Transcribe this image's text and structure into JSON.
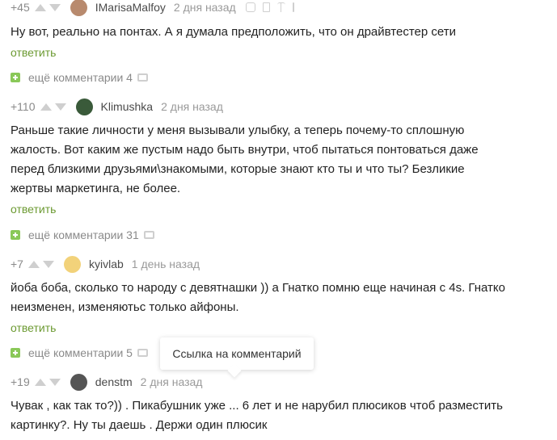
{
  "comments": [
    {
      "rating": "+45",
      "username": "IMarisaMalfoy",
      "time": "2 дня назад",
      "text": "Ну вот, реально на понтах. А я думала предположить, что он драйвтестер сети",
      "reply_label": "ответить",
      "more_label": "ещё комментарии 4",
      "avatar_color": "#b88a6e"
    },
    {
      "rating": "+110",
      "username": "Klimushka",
      "time": "2 дня назад",
      "text_lines": [
        "Раньше такие личности у меня вызывали улыбку, а теперь почему-то сплошную",
        "жалость. Вот каким же пустым надо быть внутри, чтоб пытаться понтоваться даже",
        "перед близкими друзьями\\знакомыми, которые знают кто ты и что ты? Безликие",
        "жертвы маркетинга, не более."
      ],
      "reply_label": "ответить",
      "more_label": "ещё комментарии 31",
      "avatar_color": "#3a5a3a"
    },
    {
      "rating": "+7",
      "username": "kyivlab",
      "time": "1 день назад",
      "text_lines": [
        "йоба боба, сколько то народу с девятнашки )) а Гнатко помню еще начиная с 4s. Гнатко",
        "неизменен, изменяютьс только айфоны."
      ],
      "reply_label": "ответить",
      "more_label": "ещё комментарии 5",
      "avatar_color": "#f2d27a"
    },
    {
      "rating": "+19",
      "username": "denstm",
      "time": "2 дня назад",
      "text_lines": [
        "Чувак , как так то?)) . Пикабушник уже ... 6 лет и не нарубил плюсиков чтоб разместить",
        "картинку?. Ну ты даешь . Держи один плюсик"
      ],
      "avatar_color": "#555555"
    }
  ],
  "tooltip": "Ссылка на комментарий",
  "colors": {
    "accent_green": "#6c9a32",
    "plus_green": "#8ac858",
    "muted": "#8a8a8a",
    "arrow": "#cfcfcf"
  }
}
